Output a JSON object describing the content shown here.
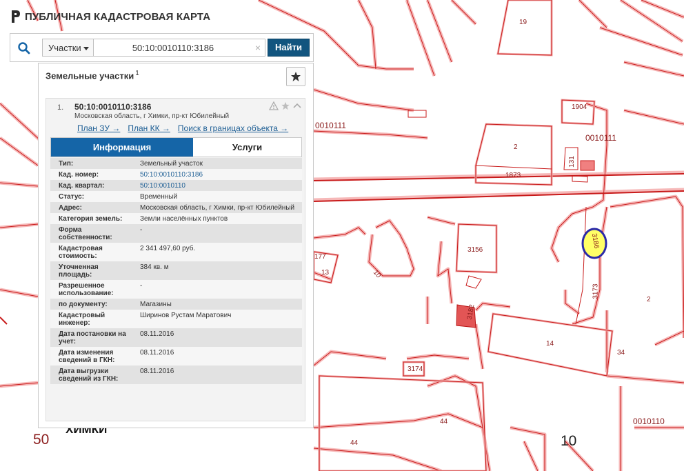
{
  "brand": {
    "title": "ПУБЛИЧНАЯ КАДАСТРОВАЯ КАРТА",
    "logo_icon": "pkk-logo-icon"
  },
  "search": {
    "type_label": "Участки",
    "query": "50:10:0010110:3186",
    "clear_glyph": "×",
    "find_label": "Найти"
  },
  "results": {
    "title": "Земельные участки",
    "count": "1",
    "item": {
      "index": "1.",
      "number": "50:10:0010110:3186",
      "address": "Московская область, г Химки, пр-кт Юбилейный",
      "links": [
        "План ЗУ →",
        "План КК →",
        "Поиск в границах объекта →"
      ],
      "tabs": {
        "info": "Информация",
        "services": "Услуги"
      },
      "props": [
        {
          "k": "Тип:",
          "v": "Земельный участок"
        },
        {
          "k": "Кад. номер:",
          "v": "50:10:0010110:3186"
        },
        {
          "k": "Кад. квартал:",
          "v": "50:10:0010110"
        },
        {
          "k": "Статус:",
          "v": "Временный"
        },
        {
          "k": "Адрес:",
          "v": "Московская область, г Химки, пр-кт Юбилейный"
        },
        {
          "k": "Категория земель:",
          "v": "Земли населённых пунктов"
        },
        {
          "k": "Форма собственности:",
          "v": "-"
        },
        {
          "k": "Кадастровая стоимость:",
          "v": "2 341 497,60 руб."
        },
        {
          "k": "Уточненная площадь:",
          "v": "384 кв. м"
        },
        {
          "k": "Разрешенное использование:",
          "v": "-"
        },
        {
          "k": "по документу:",
          "v": "Магазины"
        },
        {
          "k": "Кадастровый инженер:",
          "v": "Ширинов Рустам Маратович"
        },
        {
          "k": "Дата постановки на учет:",
          "v": "08.11.2016"
        },
        {
          "k": "Дата изменения сведений в ГКН:",
          "v": "08.11.2016"
        },
        {
          "k": "Дата выгрузки сведений из ГКН:",
          "v": "08.11.2016"
        }
      ]
    }
  },
  "map": {
    "labels": {
      "l19": "19",
      "l1904": "1904",
      "l0010111a": "0010111",
      "l0010111b": "0010111",
      "l2a": "2",
      "l1873": "1873",
      "l131": "131",
      "l3156": "3156",
      "l3186": "3186",
      "l3173": "3173",
      "l2b": "2",
      "l177": "177",
      "l13": "13",
      "l10a": "10",
      "l3182": "3182",
      "l14": "14",
      "l34": "34",
      "l3174": "3174",
      "l44a": "44",
      "l44b": "44",
      "l0010110": "0010110",
      "l50": "50",
      "l10b": "10",
      "city": "ХИМКИ"
    },
    "colors": {
      "parcel_border": "#f4b0b0",
      "parcel_line": "#c81a1a",
      "highlight_fill": "#ffff66",
      "highlight_ring": "#2222aa",
      "building_fill": "#f08080"
    }
  }
}
